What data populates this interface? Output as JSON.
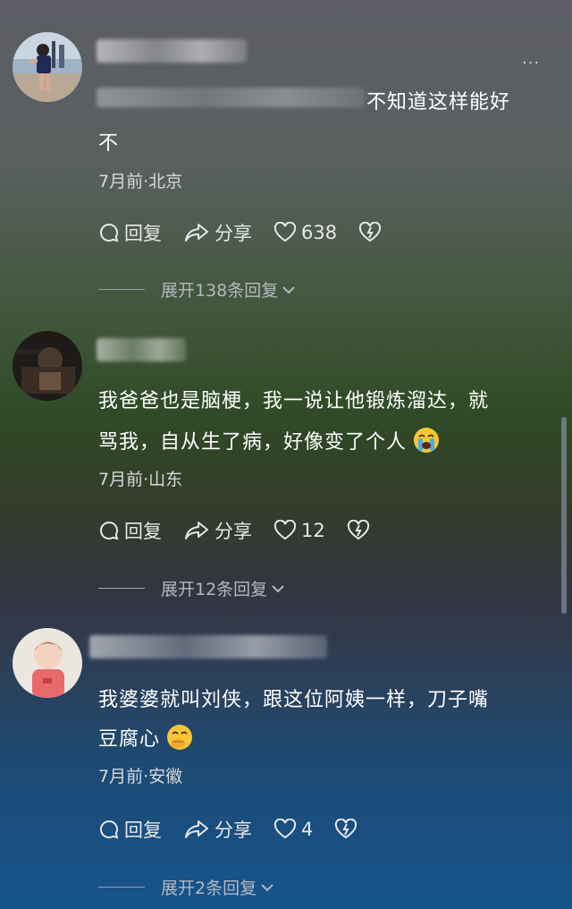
{
  "comments": [
    {
      "text_lines": [
        "不知道这样能好",
        "不"
      ],
      "meta": "7月前·北京",
      "reply_label": "回复",
      "share_label": "分享",
      "likes": "638",
      "expand_label": "展开138条回复"
    },
    {
      "text_lines": [
        "我爸爸也是脑梗，我一说让他锻炼溜达，就",
        "骂我，自从生了病，好像变了个人"
      ],
      "meta": "7月前·山东",
      "reply_label": "回复",
      "share_label": "分享",
      "likes": "12",
      "expand_label": "展开12条回复",
      "emoji": "loudly-crying-face"
    },
    {
      "text_lines": [
        "我婆婆就叫刘侠，跟这位阿姨一样，刀子嘴",
        "豆腐心"
      ],
      "meta": "7月前·安徽",
      "reply_label": "回复",
      "share_label": "分享",
      "likes": "4",
      "expand_label": "展开2条回复",
      "emoji": "hand-over-mouth-face"
    }
  ],
  "more_menu": "···",
  "icons": [
    "comment-icon",
    "share-icon",
    "heart-icon",
    "dislike-icon",
    "chevron-down-icon"
  ]
}
